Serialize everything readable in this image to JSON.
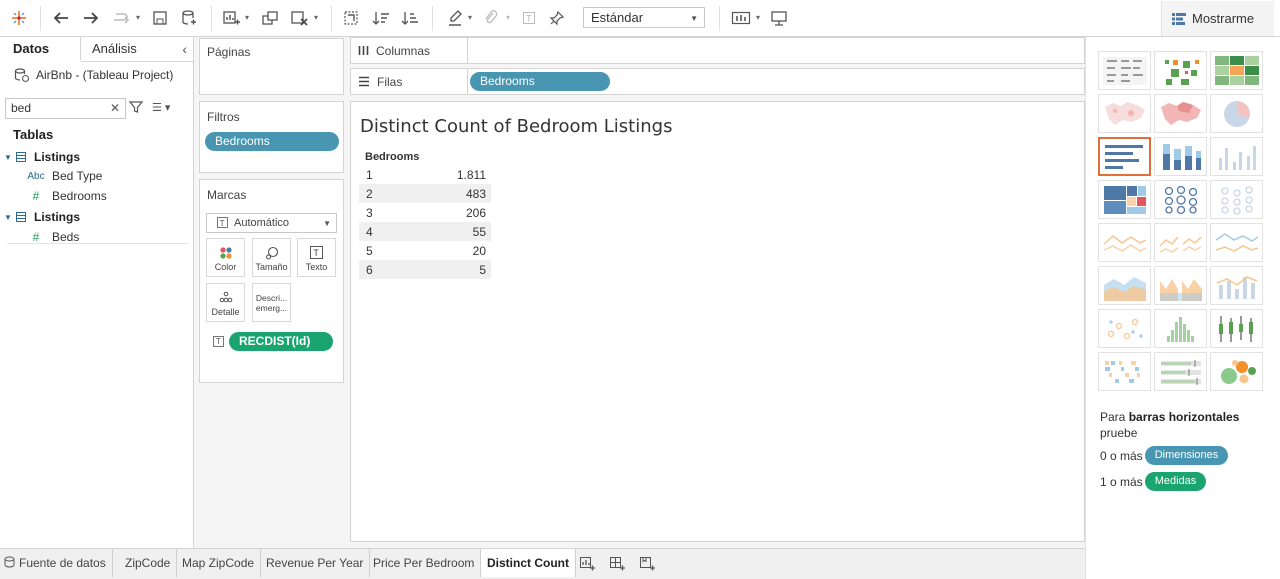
{
  "toolbar": {
    "view_mode": "Estándar",
    "show_me": "Mostrarme",
    "icons": [
      "tableau-logo-icon",
      "undo-icon",
      "redo-icon",
      "replay-icon",
      "save-icon",
      "new-datasource-icon",
      "new-worksheet-icon",
      "duplicate-icon",
      "clear-icon",
      "swap-icon",
      "sort-ascending-icon",
      "sort-descending-icon",
      "highlight-icon",
      "group-icon",
      "label-icon",
      "pin-icon",
      "fit-icon",
      "presentation-icon"
    ]
  },
  "data_pane": {
    "tab_data": "Datos",
    "tab_analysis": "Análisis",
    "datasource": "AirBnb - (Tableau Project)",
    "search_value": "bed",
    "tables_header": "Tablas",
    "tables": [
      {
        "name": "Listings",
        "fields": [
          {
            "type": "Abc",
            "name": "Bed Type"
          },
          {
            "type": "#",
            "name": "Bedrooms"
          }
        ]
      },
      {
        "name": "Listings",
        "fields": [
          {
            "type": "#",
            "name": "Beds"
          }
        ]
      }
    ]
  },
  "cards": {
    "pages": "Páginas",
    "filters": "Filtros",
    "filter_pill": "Bedrooms",
    "marks": "Marcas",
    "mark_type": "Automático",
    "mark_buttons": {
      "color": "Color",
      "size": "Tamaño",
      "text": "Texto",
      "detail": "Detalle",
      "tooltip": "Descri... emerg..."
    },
    "measure_pill": "RECDIST(Id)"
  },
  "shelves": {
    "columns": "Columnas",
    "rows": "Filas",
    "rows_pill": "Bedrooms"
  },
  "view": {
    "title": "Distinct Count of Bedroom Listings",
    "column_header": "Bedrooms",
    "rows": [
      {
        "key": "1",
        "value": "1.811"
      },
      {
        "key": "2",
        "value": "483"
      },
      {
        "key": "3",
        "value": "206"
      },
      {
        "key": "4",
        "value": "55"
      },
      {
        "key": "5",
        "value": "20"
      },
      {
        "key": "6",
        "value": "5"
      }
    ]
  },
  "show_me": {
    "tip_prefix": "Para ",
    "tip_chart": "barras horizontales",
    "tip_suffix": "pruebe",
    "req1_prefix": "0 o más",
    "req1_pill": "Dimensiones",
    "req2_prefix": "1 o más",
    "req2_pill": "Medidas"
  },
  "sheets": [
    "Fuente de datos",
    "ZipCode",
    "Map ZipCode",
    "Revenue Per Year",
    "Price Per Bedroom",
    "Distinct Count"
  ],
  "active_sheet": "Distinct Count",
  "colors": {
    "dimension_pill": "#4996b2",
    "measure_pill": "#1aa470",
    "selected_chart_border": "#e0703a"
  }
}
